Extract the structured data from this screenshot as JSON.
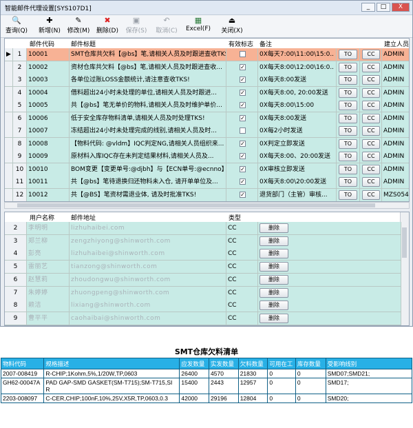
{
  "window": {
    "title": "智能邮件代理设置[SYS107D1]",
    "controls": [
      "_",
      "□",
      "X"
    ]
  },
  "toolbar": [
    {
      "label": "查询(Q)",
      "icon": "search-icon",
      "enabled": true
    },
    {
      "label": "新增(N)",
      "icon": "new-icon",
      "enabled": true
    },
    {
      "label": "修改(M)",
      "icon": "edit-icon",
      "enabled": true
    },
    {
      "label": "删除(D)",
      "icon": "delete-icon",
      "enabled": true
    },
    {
      "label": "保存(S)",
      "icon": "save-icon",
      "enabled": false
    },
    {
      "label": "取消(C)",
      "icon": "undo-icon",
      "enabled": false
    },
    {
      "label": "Excel(F)",
      "icon": "excel-icon",
      "enabled": true
    },
    {
      "label": "关闭(X)",
      "icon": "close-icon",
      "enabled": true
    }
  ],
  "mail_grid": {
    "headers": [
      "邮件代码",
      "邮件标题",
      "有效标志",
      "备注",
      "建立人员"
    ],
    "to_label": "TO",
    "cc_label": "CC",
    "rows": [
      {
        "n": "1",
        "code": "10001",
        "title": "SMT仓库共欠料【@bs】笔,请相关人员及时跟进查收TKS!",
        "valid": false,
        "note": "0X每天7:00\\11:00\\15:0..",
        "creator": "ADMIN"
      },
      {
        "n": "2",
        "code": "10002",
        "title": "资材仓库共欠料【@bs】笔,请相关人员及时跟进查收...",
        "valid": true,
        "note": "0X每天8:00\\12:00\\16:0..",
        "creator": "ADMIN"
      },
      {
        "n": "3",
        "code": "10003",
        "title": "各单位过账LOSS金额统计,请注意查收TKS!",
        "valid": true,
        "note": "0X每天8:00发送",
        "creator": "ADMIN"
      },
      {
        "n": "4",
        "code": "10004",
        "title": "借料超出24小时未处理的单位,请相关人员及时跟进...",
        "valid": true,
        "note": "0X每天8:00, 20:00发送",
        "creator": "ADMIN"
      },
      {
        "n": "5",
        "code": "10005",
        "title": "共【@bs】笔无单价的物料,请相关人员及时维护单价...",
        "valid": true,
        "note": "0X每天8:00\\15:00",
        "creator": "ADMIN"
      },
      {
        "n": "6",
        "code": "10006",
        "title": "低于安全库存物料清单,请相关人员及时处理TKS!",
        "valid": true,
        "note": "0X每天8:00发送",
        "creator": "ADMIN"
      },
      {
        "n": "7",
        "code": "10007",
        "title": "冻结超出24小时未处理完成的线别,请相关人员及时...",
        "valid": false,
        "note": "0X每2小时发送",
        "creator": "ADMIN"
      },
      {
        "n": "8",
        "code": "10008",
        "title": "【物料代码: @vldm】IQC判定NG,请相关人员组织来...",
        "valid": true,
        "note": "0X判定立即发送",
        "creator": "ADMIN"
      },
      {
        "n": "9",
        "code": "10009",
        "title": "原材料入库IQC存在未判定结果材料,请相关人员及...",
        "valid": true,
        "note": "0X每天8:00、20:00发送",
        "creator": "ADMIN"
      },
      {
        "n": "10",
        "code": "10010",
        "title": "BOM变更【变更单号:@djbh】与【ECN单号:@ecnno】,...",
        "valid": true,
        "note": "0X审核立即发送",
        "creator": "ADMIN"
      },
      {
        "n": "11",
        "code": "10011",
        "title": "共【@bs】笔待退换归还物料未入仓, 请开单单位及...",
        "valid": true,
        "note": "0X每天8:00\\20:00发送",
        "creator": "ADMIN"
      },
      {
        "n": "12",
        "code": "10012",
        "title": "共【@BS】笔资材需退业体, 请及时批准TKS!",
        "valid": true,
        "note": "退货部门（主管）审核...",
        "creator": "MZS05447"
      }
    ]
  },
  "user_grid": {
    "headers": [
      "用户名称",
      "邮件地址",
      "类型"
    ],
    "delete_label": "删除",
    "rows": [
      {
        "n": "2",
        "name": "李明明",
        "email": "lizhuhaibei.com",
        "type": "CC"
      },
      {
        "n": "3",
        "name": "郑兰柳",
        "email": "zengzhiyong@shinworth.com",
        "type": "CC"
      },
      {
        "n": "4",
        "name": "彭亮",
        "email": "lizhuhaibei@shinworth.com",
        "type": "CC"
      },
      {
        "n": "5",
        "name": "雷丽艺",
        "email": "tianzong@shinworth.com",
        "type": "CC"
      },
      {
        "n": "6",
        "name": "赵慧莉",
        "email": "zhoudongwu@shinworth.com",
        "type": "CC"
      },
      {
        "n": "7",
        "name": "朱婷婷",
        "email": "zhuongpeng@shinworth.com",
        "type": "CC"
      },
      {
        "n": "8",
        "name": "赖洁",
        "email": "lixiang@shinworth.com",
        "type": "CC"
      },
      {
        "n": "9",
        "name": "曹平平",
        "email": "caohaibai@shinworth.com",
        "type": "CC"
      }
    ]
  },
  "report": {
    "title": "SMT仓库欠料清单",
    "headers": [
      "物料代码",
      "规格描述",
      "应发数量",
      "实发数量",
      "欠料数量",
      "可用在工",
      "库存数量",
      "受影响线别"
    ],
    "rows": [
      [
        "2007-008419",
        "R-CHIP;1Kohm,5%,1/20W,TP,0603",
        "26400",
        "4570",
        "21830",
        "0",
        "0",
        "SMD07;SMD21;"
      ],
      [
        "GH62-00047A",
        "PAD GAP-SMD GASKET(SM-T715);SM-T715,SI R",
        "15400",
        "2443",
        "12957",
        "0",
        "0",
        "SMD17;"
      ],
      [
        "2203-008097",
        "C-CER,CHIP;100nF,10%,25V,X5R,TP,0603,0.3",
        "42000",
        "29196",
        "12804",
        "0",
        "0",
        "SMD20;"
      ]
    ]
  },
  "colors": {
    "selected_row": "#f7b295",
    "row_bg": "#c8ebe6",
    "report_header": "#28b0e6"
  }
}
